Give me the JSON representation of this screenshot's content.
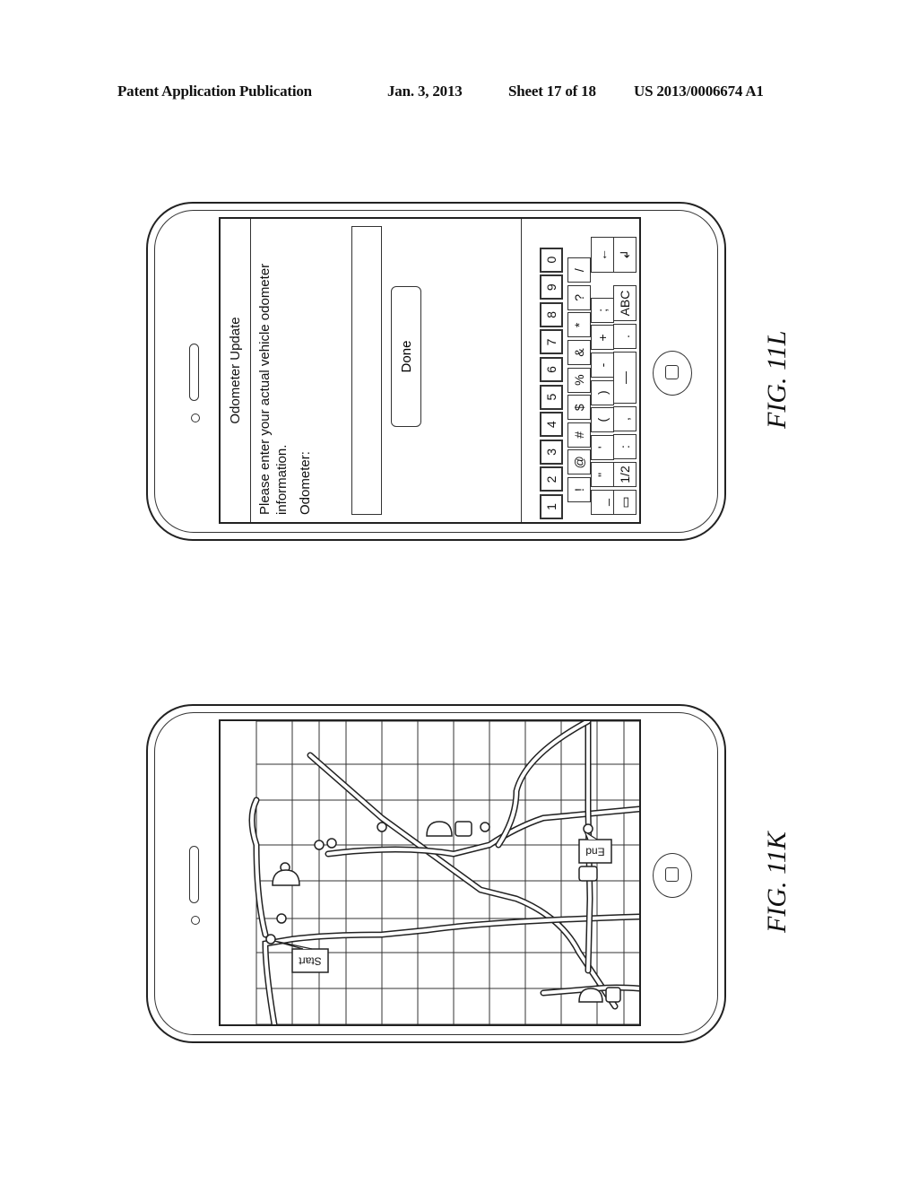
{
  "header": {
    "publication": "Patent Application Publication",
    "date": "Jan. 3, 2013",
    "sheet": "Sheet 17 of 18",
    "number": "US 2013/0006674 A1"
  },
  "figures": {
    "l": {
      "label": "FIG. 11L",
      "screen": {
        "title": "Odometer Update",
        "prompt": "Please enter your actual vehicle odometer information.",
        "field_label": "Odometer:",
        "field_value": "",
        "done_label": "Done"
      },
      "keyboard": {
        "row1": [
          "1",
          "2",
          "3",
          "4",
          "5",
          "6",
          "7",
          "8",
          "9",
          "0"
        ],
        "row2": [
          "!",
          "@",
          "#",
          "$",
          "%",
          "&",
          "*",
          "?",
          "/"
        ],
        "row3": [
          "_",
          "\"",
          "'",
          "(",
          ")",
          "-",
          "+",
          ";",
          "backspace-icon"
        ],
        "row4": [
          "keyboard-hide-icon",
          "1/2",
          ":",
          ",",
          "space-icon",
          ".",
          "ABC",
          "return-icon"
        ]
      }
    },
    "k": {
      "label": "FIG. 11K",
      "map": {
        "start_label": "Start",
        "end_label": "End"
      }
    }
  }
}
